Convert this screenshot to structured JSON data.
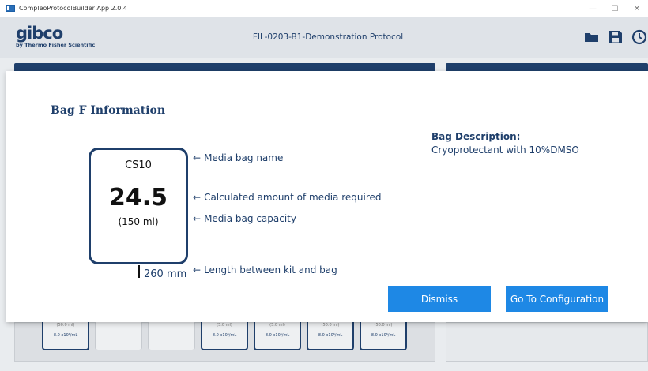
{
  "window": {
    "title": "CompleoProtocolBuilder App 2.0.4",
    "controls": [
      "—",
      "☐",
      "✕"
    ]
  },
  "header": {
    "logo_word": "gibco",
    "logo_sub": "by Thermo Fisher Scientific",
    "protocol_title": "FIL-0203-B1-Demonstration Protocol",
    "icons": [
      "folder-icon",
      "save-icon",
      "refresh-icon"
    ]
  },
  "background_cards": [
    {
      "volume": "(50.0 ml)",
      "conc": "8.0 x10⁶/mL"
    },
    {
      "volume": "",
      "conc": ""
    },
    {
      "volume": "",
      "conc": ""
    },
    {
      "volume": "(5.0 ml)",
      "conc": "8.0 x10⁶/mL"
    },
    {
      "volume": "(5.0 ml)",
      "conc": "8.0 x10⁶/mL"
    },
    {
      "volume": "(50.0 ml)",
      "conc": "8.0 x10⁶/mL"
    },
    {
      "volume": "(50.0 ml)",
      "conc": "8.0 x10⁶/mL"
    }
  ],
  "modal": {
    "title": "Bag F Information",
    "bag": {
      "name": "CS10",
      "amount": "24.5",
      "capacity": "(150 ml)",
      "tube_length": "260 mm"
    },
    "legend": {
      "name": "Media bag name",
      "amount": "Calculated amount of media required",
      "capacity": "Media bag capacity",
      "length": "Length between kit and bag"
    },
    "description_label": "Bag Description:",
    "description_value": "Cryoprotectant with 10%DMSO",
    "buttons": {
      "dismiss": "Dismiss",
      "configure": "Go To Configuration"
    }
  },
  "colors": {
    "navy": "#1f3f6b",
    "button_blue": "#1e88e5"
  }
}
